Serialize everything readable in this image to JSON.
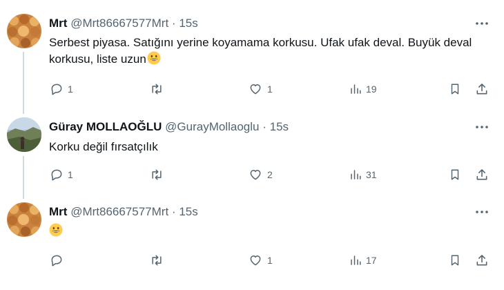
{
  "tweets": [
    {
      "name": "Mrt",
      "handle": "@Mrt86667577Mrt",
      "sep": "·",
      "time": "15s",
      "text": "Serbest piyasa. Satığını yerine koyamama korkusu. Ufak ufak deval. Buyük deval korkusu, liste uzun",
      "emoji": "grinning-face",
      "reply_count": "1",
      "retweet_count": "",
      "like_count": "1",
      "view_count": "19"
    },
    {
      "name": "Güray MOLLAOĞLU",
      "handle": "@GurayMollaoglu",
      "sep": "·",
      "time": "15s",
      "text": "Korku değil fırsatçılık",
      "emoji": "",
      "reply_count": "1",
      "retweet_count": "",
      "like_count": "2",
      "view_count": "31"
    },
    {
      "name": "Mrt",
      "handle": "@Mrt86667577Mrt",
      "sep": "·",
      "time": "15s",
      "text": "",
      "emoji": "grinning-face",
      "reply_count": "",
      "retweet_count": "",
      "like_count": "1",
      "view_count": "17"
    }
  ],
  "colors": {
    "text": "#0f1419",
    "secondary": "#536471",
    "thread_line": "#cfd9de",
    "emoji_yellow": "#ffcc4d"
  },
  "icons": [
    "more-icon",
    "reply-icon",
    "retweet-icon",
    "like-icon",
    "views-icon",
    "bookmark-icon",
    "share-icon"
  ]
}
